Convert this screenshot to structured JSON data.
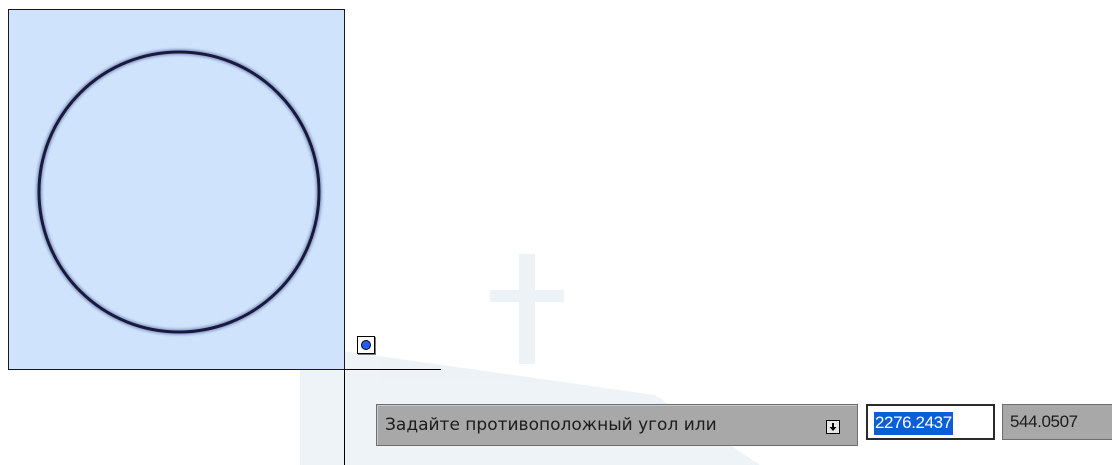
{
  "canvas": {
    "background": "#ffffff",
    "selection_fill": "#cfe3fc",
    "circle_stroke": "#1a1a3a"
  },
  "osnap": {
    "icon": "center-snap-icon",
    "accent": "#1d5cf5"
  },
  "dynamic_input": {
    "prompt": "Задайте противоположный угол или",
    "options_icon": "down-arrow-icon",
    "x_value": "2276.2437",
    "y_value": "544.0507",
    "selection_color": "#0a5fd7"
  }
}
